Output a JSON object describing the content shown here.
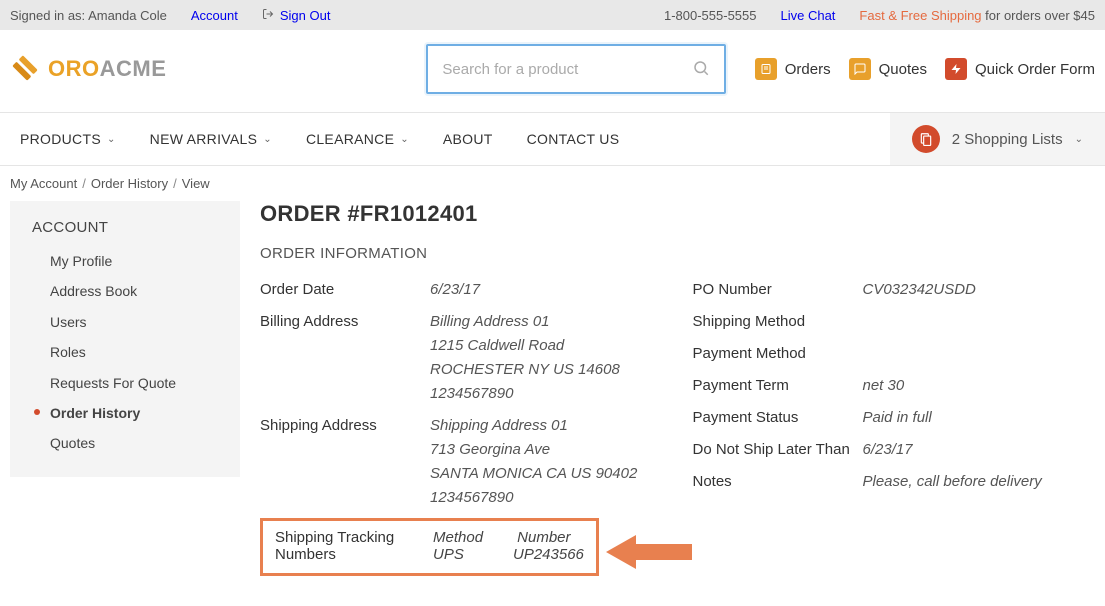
{
  "topbar": {
    "signed_in_as_label": "Signed in as:",
    "user_name": "Amanda Cole",
    "account_label": "Account",
    "sign_out_label": "Sign Out",
    "phone": "1-800-555-5555",
    "live_chat": "Live Chat",
    "promo_free": "Fast & Free Shipping",
    "promo_rest": " for orders over $45"
  },
  "header": {
    "logo_oro": "ORO",
    "logo_acme": "ACME",
    "search_placeholder": "Search for a product",
    "links": {
      "orders": "Orders",
      "quotes": "Quotes",
      "quick_order": "Quick Order Form"
    }
  },
  "nav": {
    "items": [
      "PRODUCTS",
      "NEW ARRIVALS",
      "CLEARANCE",
      "ABOUT",
      "CONTACT US"
    ],
    "shopping_lists": "2 Shopping Lists"
  },
  "breadcrumb": {
    "parts": [
      "My Account",
      "Order History",
      "View"
    ]
  },
  "sidebar": {
    "title": "ACCOUNT",
    "items": [
      "My Profile",
      "Address Book",
      "Users",
      "Roles",
      "Requests For Quote",
      "Order History",
      "Quotes"
    ],
    "active_index": 5
  },
  "order": {
    "title": "ORDER #FR1012401",
    "section_title": "ORDER INFORMATION",
    "left": {
      "order_date_label": "Order Date",
      "order_date": "6/23/17",
      "billing_label": "Billing Address",
      "billing": "Billing Address 01\n1215 Caldwell Road\nROCHESTER NY US 14608\n1234567890",
      "shipping_label": "Shipping Address",
      "shipping": "Shipping Address 01\n713 Georgina Ave\nSANTA MONICA CA US 90402\n1234567890"
    },
    "right": {
      "po_label": "PO Number",
      "po": "CV032342USDD",
      "ship_method_label": "Shipping Method",
      "ship_method": "",
      "pay_method_label": "Payment Method",
      "pay_method": "",
      "pay_term_label": "Payment Term",
      "pay_term": "net 30",
      "pay_status_label": "Payment Status",
      "pay_status": "Paid in full",
      "dnsl_label": "Do Not Ship Later Than",
      "dnsl": "6/23/17",
      "notes_label": "Notes",
      "notes": "Please, call before delivery"
    },
    "tracking": {
      "label": "Shipping Tracking Numbers",
      "head_method": "Method",
      "head_number": "Number",
      "rows": [
        {
          "method": "UPS",
          "number": "UP243566"
        }
      ]
    }
  }
}
